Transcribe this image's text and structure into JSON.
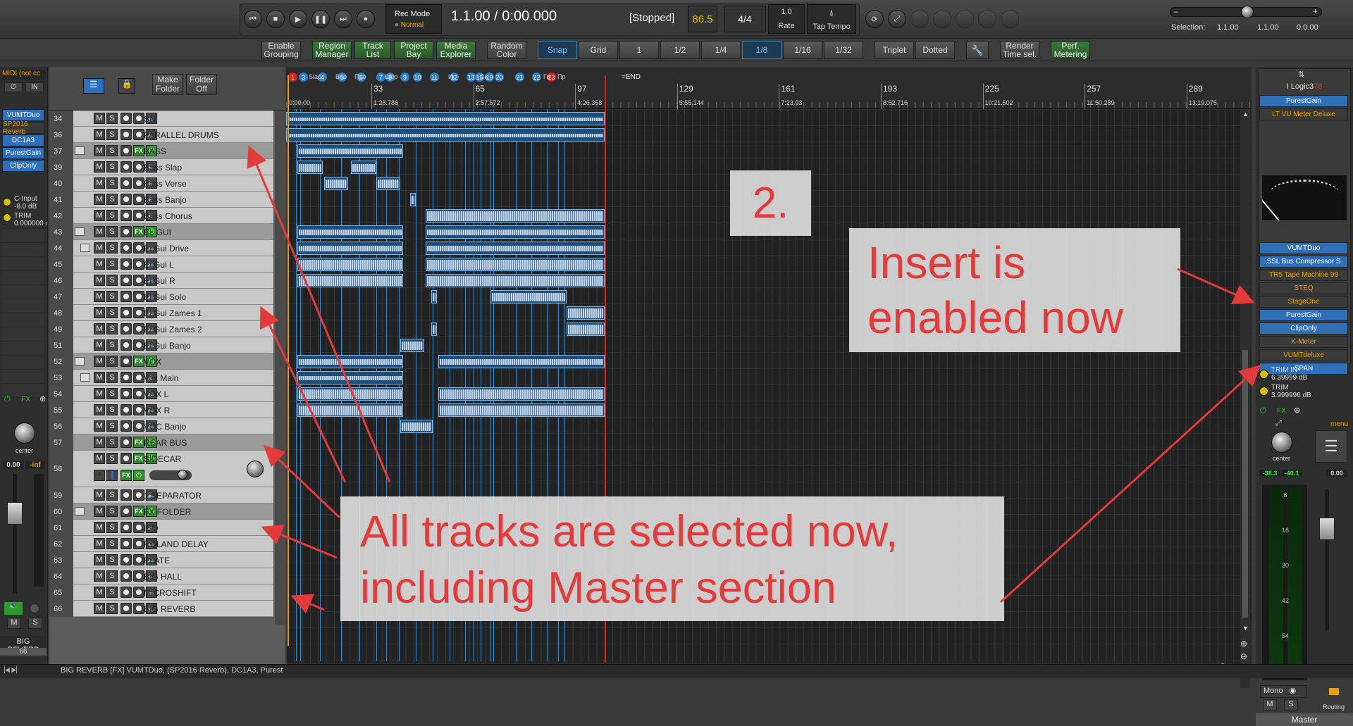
{
  "transport": {
    "rec_mode_label": "Rec Mode",
    "rec_mode_value": "Normal",
    "position": "1.1.00 / 0:00.000",
    "state": "[Stopped]",
    "tempo": "86.5",
    "time_sig": "4/4",
    "rate_value": "1.0",
    "rate_label": "Rate",
    "tap_tempo_label": "Tap Tempo",
    "selection_label": "Selection:",
    "selection_start": "1.1.00",
    "selection_end": "1.1.00",
    "selection_len": "0.0.00"
  },
  "toolbar": {
    "enable_grouping": "Enable Grouping",
    "region_manager": "Region Manager",
    "track_list": "Track List",
    "project_bay": "Project Bay",
    "media_explorer": "Media Explorer",
    "random_color": "Random Color",
    "snap": "Snap",
    "grid": "Grid",
    "g1": "1",
    "g12": "1/2",
    "g14": "1/4",
    "g18": "1/8",
    "g116": "1/16",
    "g132": "1/32",
    "triplet": "Triplet",
    "dotted": "Dotted",
    "render": "Render Time sel.",
    "perf": "Perf. Metering"
  },
  "track_header": {
    "make_folder": "Make Folder",
    "folder_off": "Folder Off"
  },
  "left_strip": {
    "midi": "MIDI (not cc",
    "in": "IN",
    "plugins": [
      "VUMTDuo",
      "SP2016 Reverb",
      "DC1A3",
      "PurestGain",
      "ClipOnly"
    ],
    "cinput_label": "C-Input",
    "cinput_val": "-8.0 dB",
    "trim_label": "TRIM",
    "trim_val": "0.000000 d",
    "fx": "FX",
    "pan": "center",
    "vol": "0.00",
    "peak": "-inf",
    "m": "M",
    "s": "S",
    "track_name": "BIG REVERB",
    "track_num": "66"
  },
  "tracks": [
    {
      "num": "34",
      "name": "SN"
    },
    {
      "num": "36",
      "name": "PARALLEL DRUMS"
    },
    {
      "num": "37",
      "name": "BASS"
    },
    {
      "num": "39",
      "name": "Bass Slap"
    },
    {
      "num": "40",
      "name": "Bass Verse"
    },
    {
      "num": "41",
      "name": "Bass Banjo"
    },
    {
      "num": "42",
      "name": "Bass Chorus"
    },
    {
      "num": "43",
      "name": "EL GUI"
    },
    {
      "num": "44",
      "name": "El Gui Drive"
    },
    {
      "num": "45",
      "name": "El Gui L"
    },
    {
      "num": "46",
      "name": "El Gui R"
    },
    {
      "num": "47",
      "name": "El Gui Solo"
    },
    {
      "num": "48",
      "name": "El Gui Zames 1"
    },
    {
      "num": "49",
      "name": "El Gui Zames  2"
    },
    {
      "num": "51",
      "name": "El Gui Banjo"
    },
    {
      "num": "52",
      "name": "VOX"
    },
    {
      "num": "53",
      "name": "Vox Main"
    },
    {
      "num": "54",
      "name": "VOX L"
    },
    {
      "num": "55",
      "name": "VOX R"
    },
    {
      "num": "56",
      "name": "VOC Banjo"
    },
    {
      "num": "57",
      "name": "REAR BUS"
    },
    {
      "num": "58",
      "name": "SIDECAR"
    },
    {
      "num": "59",
      "name": "1 SEPARATOR"
    },
    {
      "num": "60",
      "name": "FX FOLDER"
    },
    {
      "num": "61",
      "name": "ISO"
    },
    {
      "num": "62",
      "name": "ROLAND DELAY"
    },
    {
      "num": "63",
      "name": "PLATE"
    },
    {
      "num": "64",
      "name": "BIG HALL"
    },
    {
      "num": "65",
      "name": "MICROSHIFT"
    },
    {
      "num": "66",
      "name": "BIG REVERB"
    }
  ],
  "ruler": {
    "bars": [
      "33",
      "65",
      "97",
      "129",
      "161",
      "193",
      "225",
      "257",
      "289"
    ],
    "times": [
      "1:28.786",
      "2:57.572",
      "4:26.358",
      "5:55.144",
      "7:23.93",
      "8:52.716",
      "10:21.502",
      "11:50.289",
      "13:19.075"
    ],
    "start_time": "0:00.00",
    "markers": [
      "1",
      "3",
      "4",
      "5",
      "6",
      "7",
      "8",
      "9",
      "10",
      "11",
      "12",
      "13",
      "15",
      "19",
      "20",
      "21",
      "22",
      "23"
    ],
    "marker_texts": [
      "Slap",
      "Вне",
      "Про",
      "Щер",
      "Ис",
      "Ск",
      "Ги",
      "Пр"
    ],
    "end_label": "=END"
  },
  "master": {
    "title": "I Logic3",
    "title_num": "78",
    "plugins": [
      "PurestGain",
      "LT VU Meter Deluxe",
      "VUMTDuo",
      "SSL Bus Compressor S",
      "TR5 Tape Machine 99",
      "STEQ",
      "StageOne",
      "PurestGain",
      "ClipOnly",
      "K-Meter",
      "VUMTdeluxe",
      "SPAN"
    ],
    "trim_in_label": "TRIM IN",
    "trim_in_val": "6.39999 dB",
    "trim_label": "TRIM",
    "trim_val": "3.999996 dB",
    "fx": "FX",
    "menu": "menu",
    "pan": "center",
    "peak_l": "-38.3",
    "peak_r": "-40.1",
    "vol": "0.00",
    "meter_ticks": [
      "6",
      "18",
      "30",
      "42",
      "54"
    ],
    "mono": "Mono",
    "m": "M",
    "s": "S",
    "routing": "Routing",
    "name": "Master"
  },
  "annotations": {
    "step": "2.",
    "insert_note": "Insert is enabled now",
    "tracks_note": "All tracks are selected now, including Master section"
  },
  "status": {
    "text": "BIG REVERB [FX] VUMTDuo, (SP2016 Reverb), DC1A3, PurestGa"
  },
  "colors": {
    "accent_blue": "#2f6fb8",
    "annotation_red": "#e53a3a",
    "fx_green": "#2a8a2a",
    "playhead_red": "#d22222"
  }
}
